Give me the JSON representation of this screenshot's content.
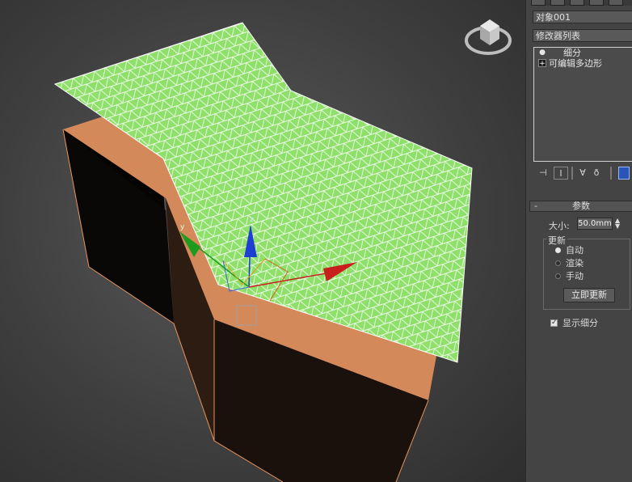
{
  "panel": {
    "object_name": "对象001",
    "modifier_list": "修改器列表",
    "stack": [
      {
        "label": "细分",
        "icon": "lightbulb-icon"
      },
      {
        "label": "可编辑多边形",
        "icon": "expand-plus-icon"
      }
    ],
    "stack_tools": [
      "pin-stack-icon",
      "show-end-result-icon",
      "make-unique-icon",
      "remove-modifier-icon",
      "configure-sets-icon"
    ],
    "params": {
      "title": "参数",
      "size_label": "大小:",
      "size_value": "50.0mm",
      "update_group": "更新",
      "radio_auto": "自动",
      "radio_render": "渲染",
      "radio_manual": "手动",
      "selected_update": "自动",
      "update_now": "立即更新",
      "show_subdivision": "显示细分",
      "show_subdivision_checked": true
    }
  },
  "viewport": {
    "gizmo_labels": {
      "x": "x",
      "y": "y",
      "z": "z"
    },
    "colors": {
      "mesh_green": "#8ee06a",
      "wire_white": "#ffffff",
      "side_orange": "#d4895a",
      "dark_face": "#0e0a08",
      "axis_x": "#c81e1e",
      "axis_y": "#1e9a1e",
      "axis_z": "#1e3fd0"
    }
  }
}
